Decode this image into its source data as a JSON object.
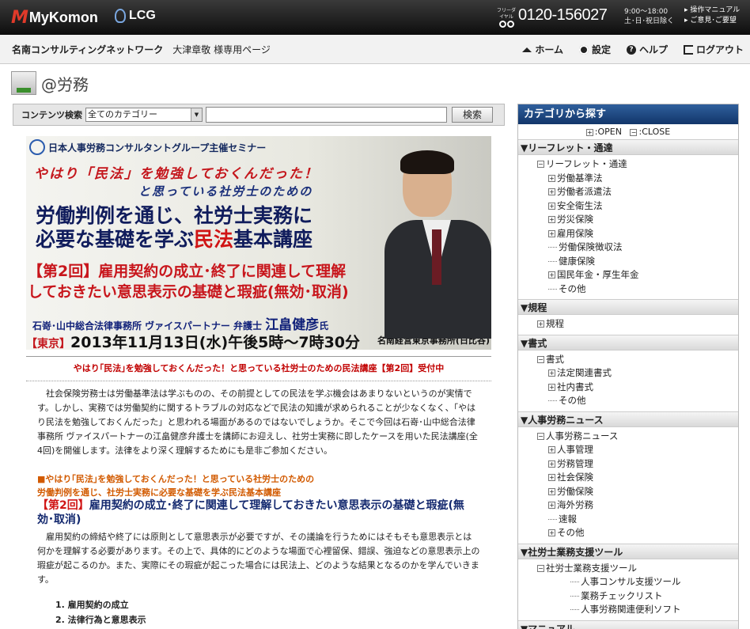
{
  "header": {
    "logo_mykomon": "MyKomon",
    "logo_lcg": "LCG",
    "freedial_label": "フリーダイヤル",
    "phone": "0120-156027",
    "hours_1": "9:00～18:00",
    "hours_2": "土･日･祝日除く",
    "link_manual": "▸ 操作マニュアル",
    "link_opinion": "▸ ご意見･ご要望"
  },
  "subheader": {
    "network": "名南コンサルティングネットワーク",
    "user": "大津章敬 様専用ページ",
    "nav": {
      "home": "ホーム",
      "settings": "設定",
      "help": "ヘルプ",
      "logout": "ログアウト"
    }
  },
  "page_title": "@労務",
  "search": {
    "label": "コンテンツ検索",
    "category": "全てのカテゴリー",
    "button": "検索"
  },
  "banner": {
    "org": "日本人事労務コンサルタントグループ主催セミナー",
    "line1": "やはり「民法」を勉強しておくんだった！",
    "line2": "と思っている社労士のための",
    "line3a": "労働判例を通じ、社労士実務に",
    "line3b": "必要な基礎を学ぶ",
    "line3c": "民法",
    "line3d": "基本講座",
    "line4a": "【第2回】",
    "line4b": "雇用契約の成立･終了に関連して理解",
    "line4c": "しておきたい意思表示の基礎と瑕疵(無効･取消)",
    "lecturer": "石嵜･山中総合法律事務所 ヴァイスパートナー 弁護士",
    "name": "江畠健彦",
    "honorific": "氏",
    "place": "【東京】",
    "date": "2013年11月13日(水)午後5時～7時30分",
    "venue": "名南経営東京事務所(日比谷)"
  },
  "caption": "やはり｢民法｣を勉強しておくんだった！と思っている社労士のための民法講座【第2回】受付中",
  "intro": "社会保険労務士は労働基準法は学ぶものの、その前提としての民法を学ぶ機会はあまりないというのが実情です。しかし、実務では労働契約に関するトラブルの対応などで民法の知識が求められることが少なくなく、「やはり民法を勉強しておくんだった」と思われる場面があるのではないでしょうか。そこで今回は石嵜･山中総合法律事務所 ヴァイスパートナーの江畠健彦弁護士を講師にお迎えし、社労士実務に即したケースを用いた民法講座(全4回)を開催します。法律をより深く理解するためにも是非ご参加ください。",
  "section": {
    "h1": "■やはり｢民法｣を勉強しておくんだった！と思っている社労士のための",
    "h2": "労働判例を通じ、社労士実務に必要な基礎を学ぶ民法基本講座",
    "h3_red": "【第2回】",
    "h3": "雇用契約の成立･終了に関連して理解しておきたい意思表示の基礎と瑕疵(無効･取消)",
    "body": "雇用契約の締結や終了には原則として意思表示が必要ですが、その議論を行うためにはそもそも意思表示とは何かを理解する必要があります。その上で、具体的にどのような場面で心裡留保、錯誤、強迫などの意思表示上の瑕疵が起こるのか。また、実際にその瑕疵が起こった場合には民法上、どのような結果となるのかを学んでいきます。",
    "list": [
      "1.  雇用契約の成立",
      "2.  法律行為と意思表示"
    ]
  },
  "sidebar": {
    "title": "カテゴリから探す",
    "open": ":OPEN",
    "close": ":CLOSE",
    "groups": [
      {
        "head": "▼リーフレット・通達",
        "sub": "リーフレット・通達",
        "items": [
          "労働基準法",
          "労働者派遣法",
          "安全衛生法",
          "労災保険",
          "雇用保険",
          "労働保険徴収法",
          "健康保険",
          "国民年金・厚生年金",
          "その他"
        ]
      },
      {
        "head": "▼規程",
        "sub": "規程"
      },
      {
        "head": "▼書式",
        "sub": "書式",
        "items": [
          "法定関連書式",
          "社内書式",
          "その他"
        ]
      },
      {
        "head": "▼人事労務ニュース",
        "sub": "人事労務ニュース",
        "items": [
          "人事管理",
          "労務管理",
          "社会保険",
          "労働保険",
          "海外労務",
          "速報",
          "その他"
        ]
      },
      {
        "head": "▼社労士業務支援ツール",
        "sub": "社労士業務支援ツール",
        "items": [
          "人事コンサル支援ツール",
          "業務チェックリスト",
          "人事労務関連便利ソフト"
        ]
      },
      {
        "head": "▼マニュアル"
      }
    ]
  }
}
